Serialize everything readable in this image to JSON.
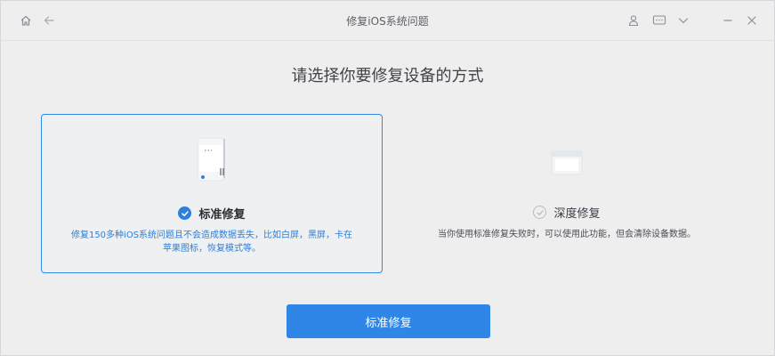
{
  "window": {
    "title": "修复iOS系统问题"
  },
  "toolbar": {
    "icons": [
      "home-icon",
      "back-arrow-icon",
      "user-icon",
      "feedback-icon",
      "dropdown-chevron-icon",
      "minimize-icon",
      "close-icon"
    ]
  },
  "main": {
    "heading": "请选择你要修复设备的方式",
    "options": [
      {
        "title": "标准修复",
        "description": "修复150多种iOS系统问题且不会造成数据丢失，比如白屏，黑屏，卡在苹果图标，恢复模式等。",
        "selected": true,
        "icon": "phone-device-icon"
      },
      {
        "title": "深度修复",
        "description": "当你使用标准修复失败时，可以使用此功能，但会清除设备数据。",
        "selected": false,
        "icon": "device-box-icon"
      }
    ],
    "action_button": "标准修复"
  },
  "colors": {
    "accent": "#2f86e6",
    "selected_border": "#2e8ae6",
    "description_blue": "#2f7fd6",
    "background": "#eeeeef"
  }
}
